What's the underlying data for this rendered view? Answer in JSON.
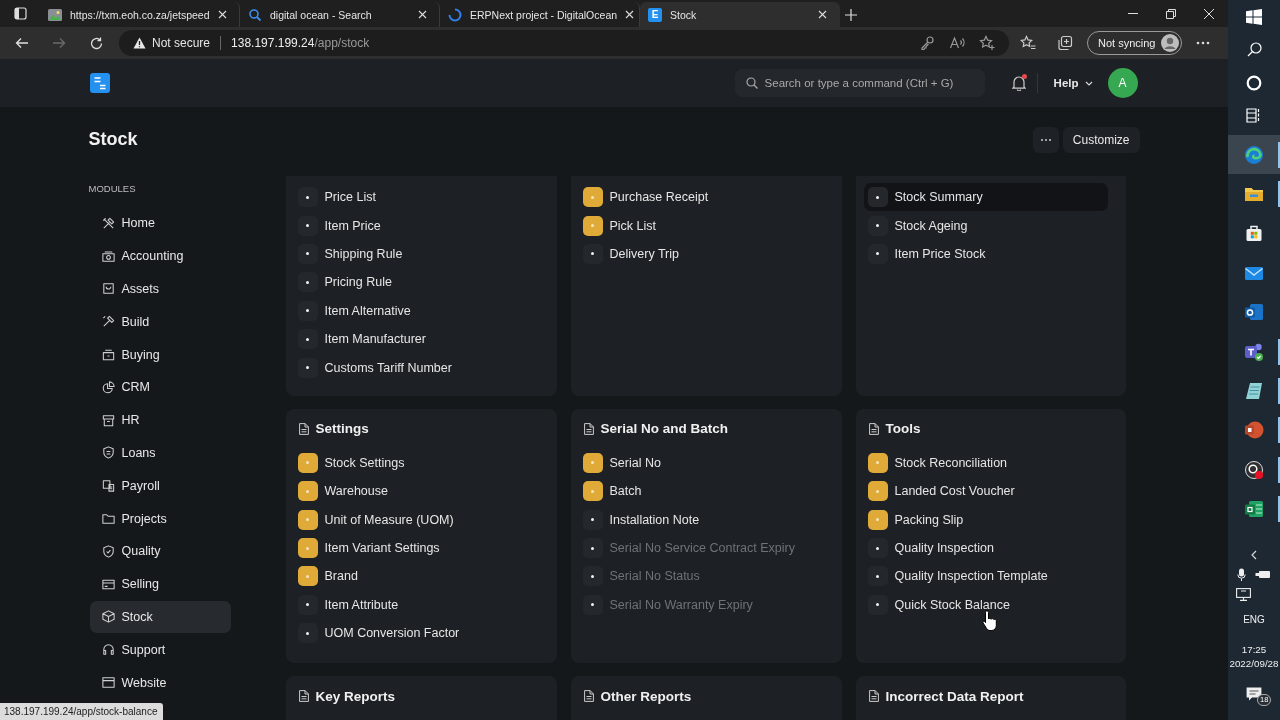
{
  "browser": {
    "tabs": [
      {
        "title": "https://txm.eoh.co.za/jetspeed",
        "selected": false
      },
      {
        "title": "digital ocean - Search",
        "selected": false
      },
      {
        "title": "ERPNext project - DigitalOcean",
        "selected": false
      },
      {
        "title": "Stock",
        "icon_letter": "E",
        "selected": true
      }
    ],
    "back_button": {
      "disabled": false
    },
    "forward_button": {
      "disabled": true
    },
    "address_bar": {
      "security": "Not secure",
      "host": "138.197.199.24",
      "path": "/app/stock"
    },
    "sync_button": "Not syncing",
    "status_url": "138.197.199.24/app/stock-balance"
  },
  "navbar": {
    "search": {
      "placeholder": "Search or type a command (Ctrl + G)"
    },
    "notifications_unread": true,
    "help": "Help",
    "avatar": "A"
  },
  "page": {
    "title": "Stock",
    "customize_button": "Customize"
  },
  "sidebar": {
    "heading": "MODULES",
    "items": [
      {
        "label": "Home",
        "selected": false
      },
      {
        "label": "Accounting",
        "selected": false
      },
      {
        "label": "Assets",
        "selected": false
      },
      {
        "label": "Build",
        "selected": false
      },
      {
        "label": "Buying",
        "selected": false
      },
      {
        "label": "CRM",
        "selected": false
      },
      {
        "label": "HR",
        "selected": false
      },
      {
        "label": "Loans",
        "selected": false
      },
      {
        "label": "Payroll",
        "selected": false
      },
      {
        "label": "Projects",
        "selected": false
      },
      {
        "label": "Quality",
        "selected": false
      },
      {
        "label": "Selling",
        "selected": false
      },
      {
        "label": "Stock",
        "selected": true
      },
      {
        "label": "Support",
        "selected": false
      },
      {
        "label": "Website",
        "selected": false
      }
    ]
  },
  "cards": [
    {
      "items": [
        {
          "label": "Price List",
          "onboard": false,
          "disabled": false,
          "highlighted": false
        },
        {
          "label": "Item Price",
          "onboard": false,
          "disabled": false,
          "highlighted": false
        },
        {
          "label": "Shipping Rule",
          "onboard": false,
          "disabled": false,
          "highlighted": false
        },
        {
          "label": "Pricing Rule",
          "onboard": false,
          "disabled": false,
          "highlighted": false
        },
        {
          "label": "Item Alternative",
          "onboard": false,
          "disabled": false,
          "highlighted": false
        },
        {
          "label": "Item Manufacturer",
          "onboard": false,
          "disabled": false,
          "highlighted": false
        },
        {
          "label": "Customs Tariff Number",
          "onboard": false,
          "disabled": false,
          "highlighted": false
        }
      ]
    },
    {
      "items": [
        {
          "label": "Purchase Receipt",
          "onboard": true,
          "disabled": false,
          "highlighted": false
        },
        {
          "label": "Pick List",
          "onboard": true,
          "disabled": false,
          "highlighted": false
        },
        {
          "label": "Delivery Trip",
          "onboard": false,
          "disabled": false,
          "highlighted": false
        }
      ]
    },
    {
      "items": [
        {
          "label": "Stock Summary",
          "onboard": false,
          "disabled": false,
          "highlighted": true
        },
        {
          "label": "Stock Ageing",
          "onboard": false,
          "disabled": false,
          "highlighted": false
        },
        {
          "label": "Item Price Stock",
          "onboard": false,
          "disabled": false,
          "highlighted": false
        }
      ]
    },
    {
      "title": "Settings",
      "items": [
        {
          "label": "Stock Settings",
          "onboard": true,
          "disabled": false,
          "highlighted": false
        },
        {
          "label": "Warehouse",
          "onboard": true,
          "disabled": false,
          "highlighted": false
        },
        {
          "label": "Unit of Measure (UOM)",
          "onboard": true,
          "disabled": false,
          "highlighted": false
        },
        {
          "label": "Item Variant Settings",
          "onboard": true,
          "disabled": false,
          "highlighted": false
        },
        {
          "label": "Brand",
          "onboard": true,
          "disabled": false,
          "highlighted": false
        },
        {
          "label": "Item Attribute",
          "onboard": false,
          "disabled": false,
          "highlighted": false
        },
        {
          "label": "UOM Conversion Factor",
          "onboard": false,
          "disabled": false,
          "highlighted": false
        }
      ]
    },
    {
      "title": "Serial No and Batch",
      "items": [
        {
          "label": "Serial No",
          "onboard": true,
          "disabled": false,
          "highlighted": false
        },
        {
          "label": "Batch",
          "onboard": true,
          "disabled": false,
          "highlighted": false
        },
        {
          "label": "Installation Note",
          "onboard": false,
          "disabled": false,
          "highlighted": false
        },
        {
          "label": "Serial No Service Contract Expiry",
          "onboard": false,
          "disabled": true,
          "highlighted": false
        },
        {
          "label": "Serial No Status",
          "onboard": false,
          "disabled": true,
          "highlighted": false
        },
        {
          "label": "Serial No Warranty Expiry",
          "onboard": false,
          "disabled": true,
          "highlighted": false
        }
      ]
    },
    {
      "title": "Tools",
      "items": [
        {
          "label": "Stock Reconciliation",
          "onboard": true,
          "disabled": false,
          "highlighted": false
        },
        {
          "label": "Landed Cost Voucher",
          "onboard": true,
          "disabled": false,
          "highlighted": false
        },
        {
          "label": "Packing Slip",
          "onboard": true,
          "disabled": false,
          "highlighted": false
        },
        {
          "label": "Quality Inspection",
          "onboard": false,
          "disabled": false,
          "highlighted": false
        },
        {
          "label": "Quality Inspection Template",
          "onboard": false,
          "disabled": false,
          "highlighted": false
        },
        {
          "label": "Quick Stock Balance",
          "onboard": false,
          "disabled": false,
          "highlighted": false
        }
      ]
    },
    {
      "title": "Key Reports"
    },
    {
      "title": "Other Reports"
    },
    {
      "title": "Incorrect Data Report"
    }
  ],
  "taskbar": {
    "apps": [
      {
        "kind": "browser",
        "selected": true,
        "running": true
      },
      {
        "kind": "folder",
        "selected": false,
        "running": true
      },
      {
        "kind": "store",
        "selected": false,
        "running": false
      },
      {
        "kind": "mail",
        "selected": false,
        "running": false
      },
      {
        "kind": "email-client",
        "selected": false,
        "running": false
      },
      {
        "kind": "chat",
        "selected": false,
        "running": true
      },
      {
        "kind": "notes",
        "selected": false,
        "running": true
      },
      {
        "kind": "presentation",
        "selected": false,
        "running": true
      },
      {
        "kind": "recorder",
        "selected": false,
        "running": true
      },
      {
        "kind": "spreadsheet",
        "selected": false,
        "running": true
      }
    ],
    "language": "ENG",
    "time": "17:25",
    "date": "2022/09/28",
    "notification_count": "18"
  }
}
